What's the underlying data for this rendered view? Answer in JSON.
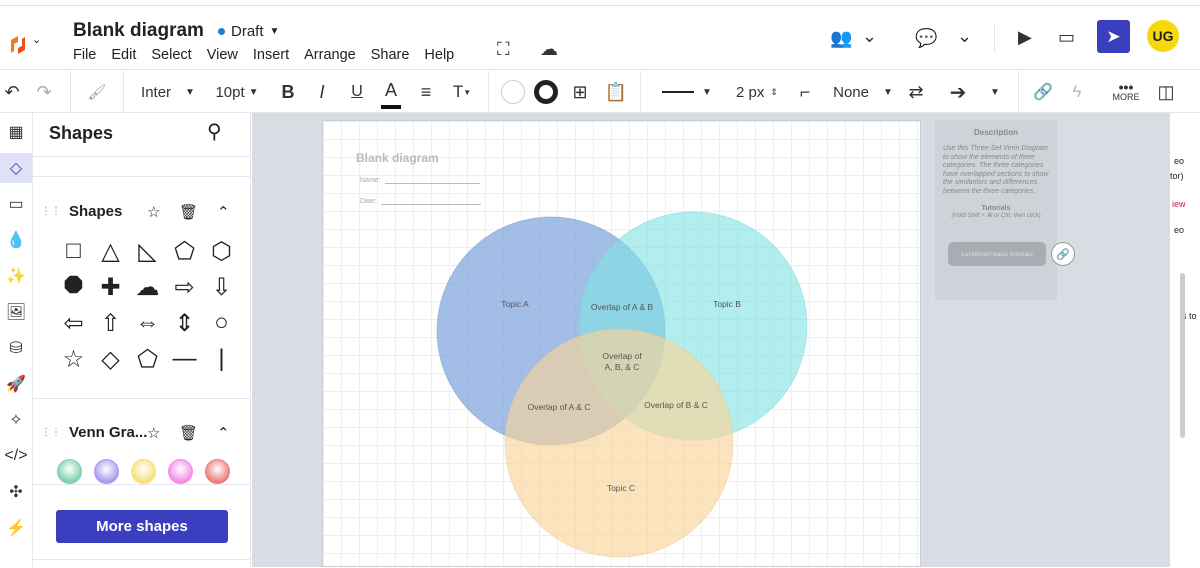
{
  "header": {
    "title": "Blank diagram",
    "status": "Draft",
    "menu": [
      "File",
      "Edit",
      "Select",
      "View",
      "Insert",
      "Arrange",
      "Share",
      "Help"
    ],
    "avatar": "UG",
    "avatar_color": "#f5d90a",
    "share_color": "#3a3fc0"
  },
  "toolbar": {
    "font": "Inter",
    "size": "10pt",
    "bold": "B",
    "italic": "I",
    "underline": "U",
    "color": "A",
    "textopt": "T",
    "line_width": "2 px",
    "endpoint": "None",
    "more": "MORE"
  },
  "panel": {
    "title": "Shapes",
    "section1": "Shapes",
    "section2": "Venn Gra...",
    "shapes": [
      "□",
      "△",
      "◺",
      "⬠",
      "⬡",
      "⯃",
      "✚",
      "☁",
      "⇨",
      "⇩",
      "⇦",
      "⇧",
      "⇔",
      "⇕",
      "○",
      "☆",
      "◇",
      "⬠",
      "—",
      "|"
    ],
    "venn_colors": [
      "#7fd1b0",
      "#a99cf0",
      "#f3e27a",
      "#f08ee8",
      "#ef7d7d"
    ],
    "more_shapes": "More shapes"
  },
  "page": {
    "title": "Blank diagram",
    "name_label": "Name:",
    "date_label": "Date:"
  },
  "venn": {
    "a": "Topic A",
    "b": "Topic B",
    "c": "Topic C",
    "ab": "Overlap of A & B",
    "ac": "Overlap of A & C",
    "bc": "Overlap of B & C",
    "abc1": "Overlap of",
    "abc2": "A, B, & C",
    "color_a": "#7aa3dc",
    "color_b": "#7fe3e3",
    "color_c": "#f9d49a"
  },
  "description": {
    "heading": "Description",
    "body": "Use this Three-Set Venn Diagram to show the elements of three categories. The three categories have overlapped sections to show the similarities and differences between the three categories.",
    "tutorials": "Tutorials",
    "hint": "(Hold Shift + ⌘ or Ctrl, then click)",
    "button": "Lucidchart basic tutorials"
  },
  "right_panel": {
    "lines": [
      "eo",
      "tor)",
      "iew",
      "eo",
      "s to"
    ]
  }
}
